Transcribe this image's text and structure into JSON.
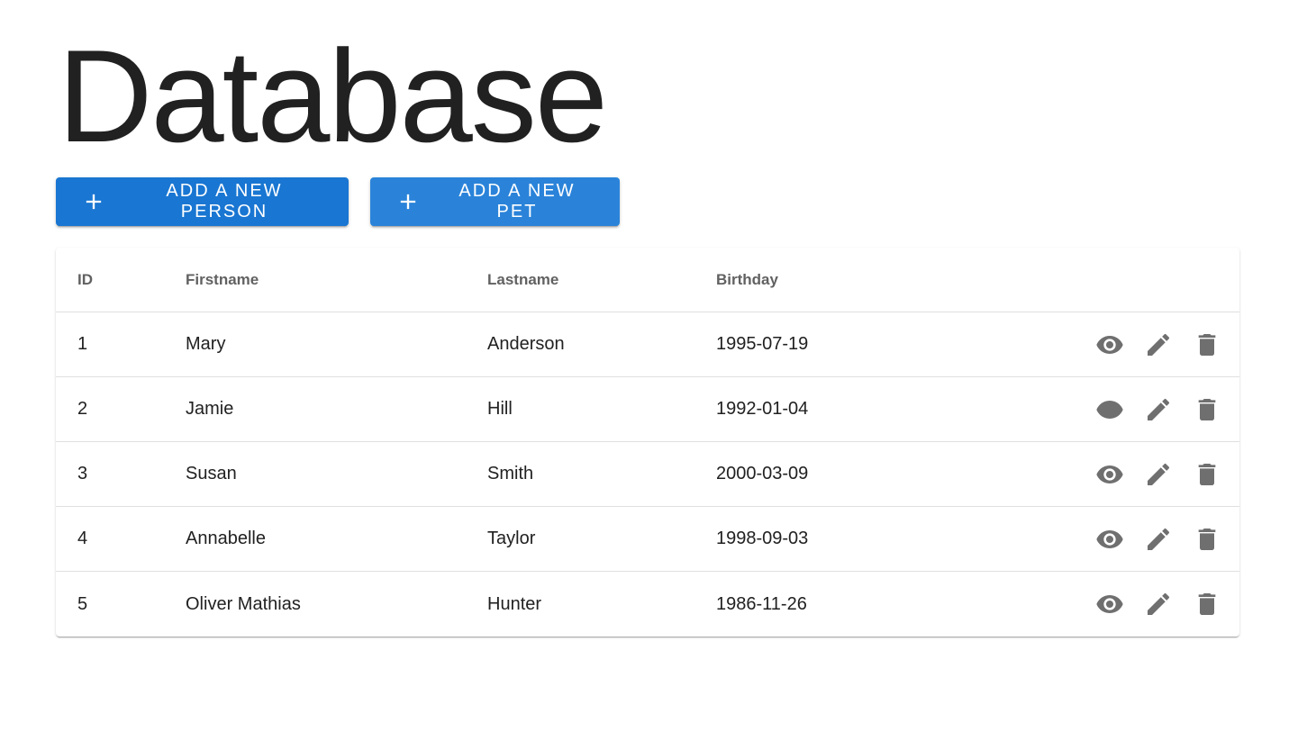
{
  "page": {
    "title": "Database"
  },
  "toolbar": {
    "add_person_label": "Add a new person",
    "add_pet_label": "Add a new pet"
  },
  "table": {
    "headers": {
      "id": "ID",
      "firstname": "Firstname",
      "lastname": "Lastname",
      "birthday": "Birthday"
    },
    "rows": [
      {
        "id": "1",
        "firstname": "Mary",
        "lastname": "Anderson",
        "birthday": "1995-07-19"
      },
      {
        "id": "2",
        "firstname": "Jamie",
        "lastname": "Hill",
        "birthday": "1992-01-04"
      },
      {
        "id": "3",
        "firstname": "Susan",
        "lastname": "Smith",
        "birthday": "2000-03-09"
      },
      {
        "id": "4",
        "firstname": "Annabelle",
        "lastname": "Taylor",
        "birthday": "1998-09-03"
      },
      {
        "id": "5",
        "firstname": "Oliver Mathias",
        "lastname": "Hunter",
        "birthday": "1986-11-26"
      }
    ],
    "row_actions": [
      "eye-icon",
      "pencil-icon",
      "trash-icon"
    ]
  },
  "colors": {
    "primary": "#1976d2",
    "primary_light": "#2a83d9",
    "icon_gray": "#6f6f6f",
    "header_text": "#616161",
    "divider": "#e0e0e0"
  }
}
